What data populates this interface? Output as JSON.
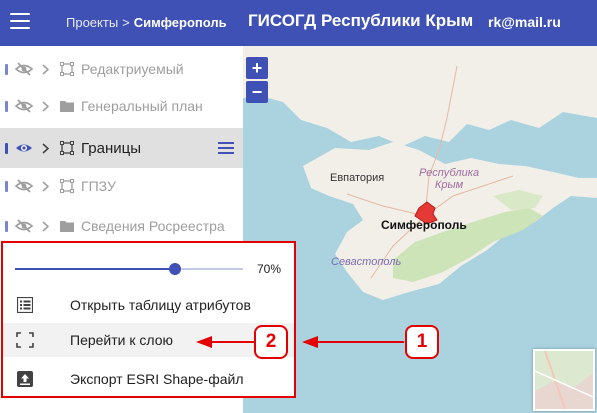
{
  "colors": {
    "header": "#3f51b5",
    "accent": "#3f51b5",
    "annotation": "#e30000",
    "selection": "#e0e0e0"
  },
  "header": {
    "menu_icon": "hamburger-icon",
    "breadcrumb": {
      "parent": "Проекты",
      "separator": ">",
      "current": "Симферополь"
    },
    "title": "ГИСОГД Республики Крым",
    "user": "rk@mail.ru"
  },
  "layers": [
    {
      "name": "Редактриуемый",
      "type_icon": "polygon-icon",
      "visible": false,
      "active": false
    },
    {
      "name": "Генеральный план",
      "type_icon": "folder-icon",
      "visible": false,
      "active": false
    },
    {
      "name": "Границы",
      "type_icon": "polygon-icon",
      "visible": true,
      "active": true
    },
    {
      "name": "ГПЗУ",
      "type_icon": "polygon-icon",
      "visible": false,
      "active": false
    },
    {
      "name": "Сведения Росреестра",
      "type_icon": "folder-icon",
      "visible": false,
      "active": false
    }
  ],
  "layer_popup": {
    "opacity": 70,
    "opacity_label": "70%",
    "actions": [
      {
        "label": "Открыть таблицу атрибутов",
        "icon": "table-icon"
      },
      {
        "label": "Перейти к слою",
        "icon": "zoom-extent-icon",
        "highlighted": true
      },
      {
        "label": "Экспорт ESRI Shape-файл",
        "icon": "export-icon"
      }
    ]
  },
  "map": {
    "zoom_in": "+",
    "zoom_out": "−",
    "labels": {
      "region": "Республика Крым",
      "evpatoria": "Евпатория",
      "simferopol": "Симферополь",
      "sevastopol": "Севастополь"
    }
  },
  "annotations": {
    "step1": "1",
    "step2": "2"
  }
}
